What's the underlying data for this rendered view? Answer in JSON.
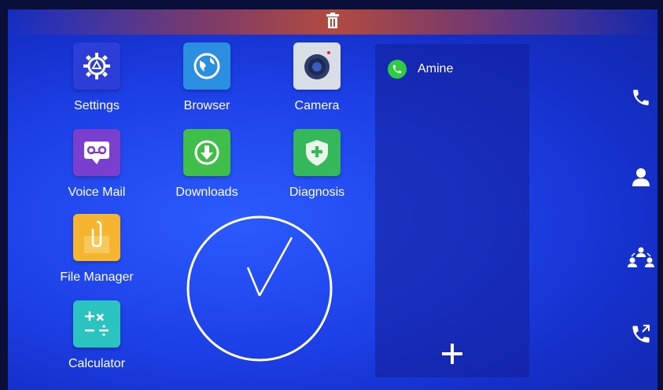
{
  "apps": [
    {
      "id": "settings",
      "label": "Settings",
      "icon": "settings-gear-icon",
      "color": "#2d3ed8"
    },
    {
      "id": "browser",
      "label": "Browser",
      "icon": "globe-icon",
      "color": "#2a8fe0"
    },
    {
      "id": "camera",
      "label": "Camera",
      "icon": "camera-lens-icon",
      "color": "#d8dde6"
    },
    {
      "id": "voicemail",
      "label": "Voice Mail",
      "icon": "voicemail-icon",
      "color": "#7b3fd0"
    },
    {
      "id": "downloads",
      "label": "Downloads",
      "icon": "download-arrow-icon",
      "color": "#3fbf4a"
    },
    {
      "id": "diagnosis",
      "label": "Diagnosis",
      "icon": "shield-plus-icon",
      "color": "#34b85a"
    },
    {
      "id": "filemanager",
      "label": "File Manager",
      "icon": "folder-clip-icon",
      "color": "#f5b531"
    },
    {
      "id": "calculator",
      "label": "Calculator",
      "icon": "calculator-icon",
      "color": "#2bc3c0"
    }
  ],
  "contacts_panel": {
    "contacts": [
      {
        "name": "Amine",
        "status_color": "#2ecc40"
      }
    ],
    "add_label": "+"
  },
  "sidebar": [
    {
      "id": "dialer",
      "icon": "phone-icon"
    },
    {
      "id": "contacts",
      "icon": "person-icon"
    },
    {
      "id": "conference",
      "icon": "group-icon"
    },
    {
      "id": "call-forward",
      "icon": "phone-forward-icon"
    }
  ],
  "top_bar": {
    "icon": "trash-icon"
  }
}
